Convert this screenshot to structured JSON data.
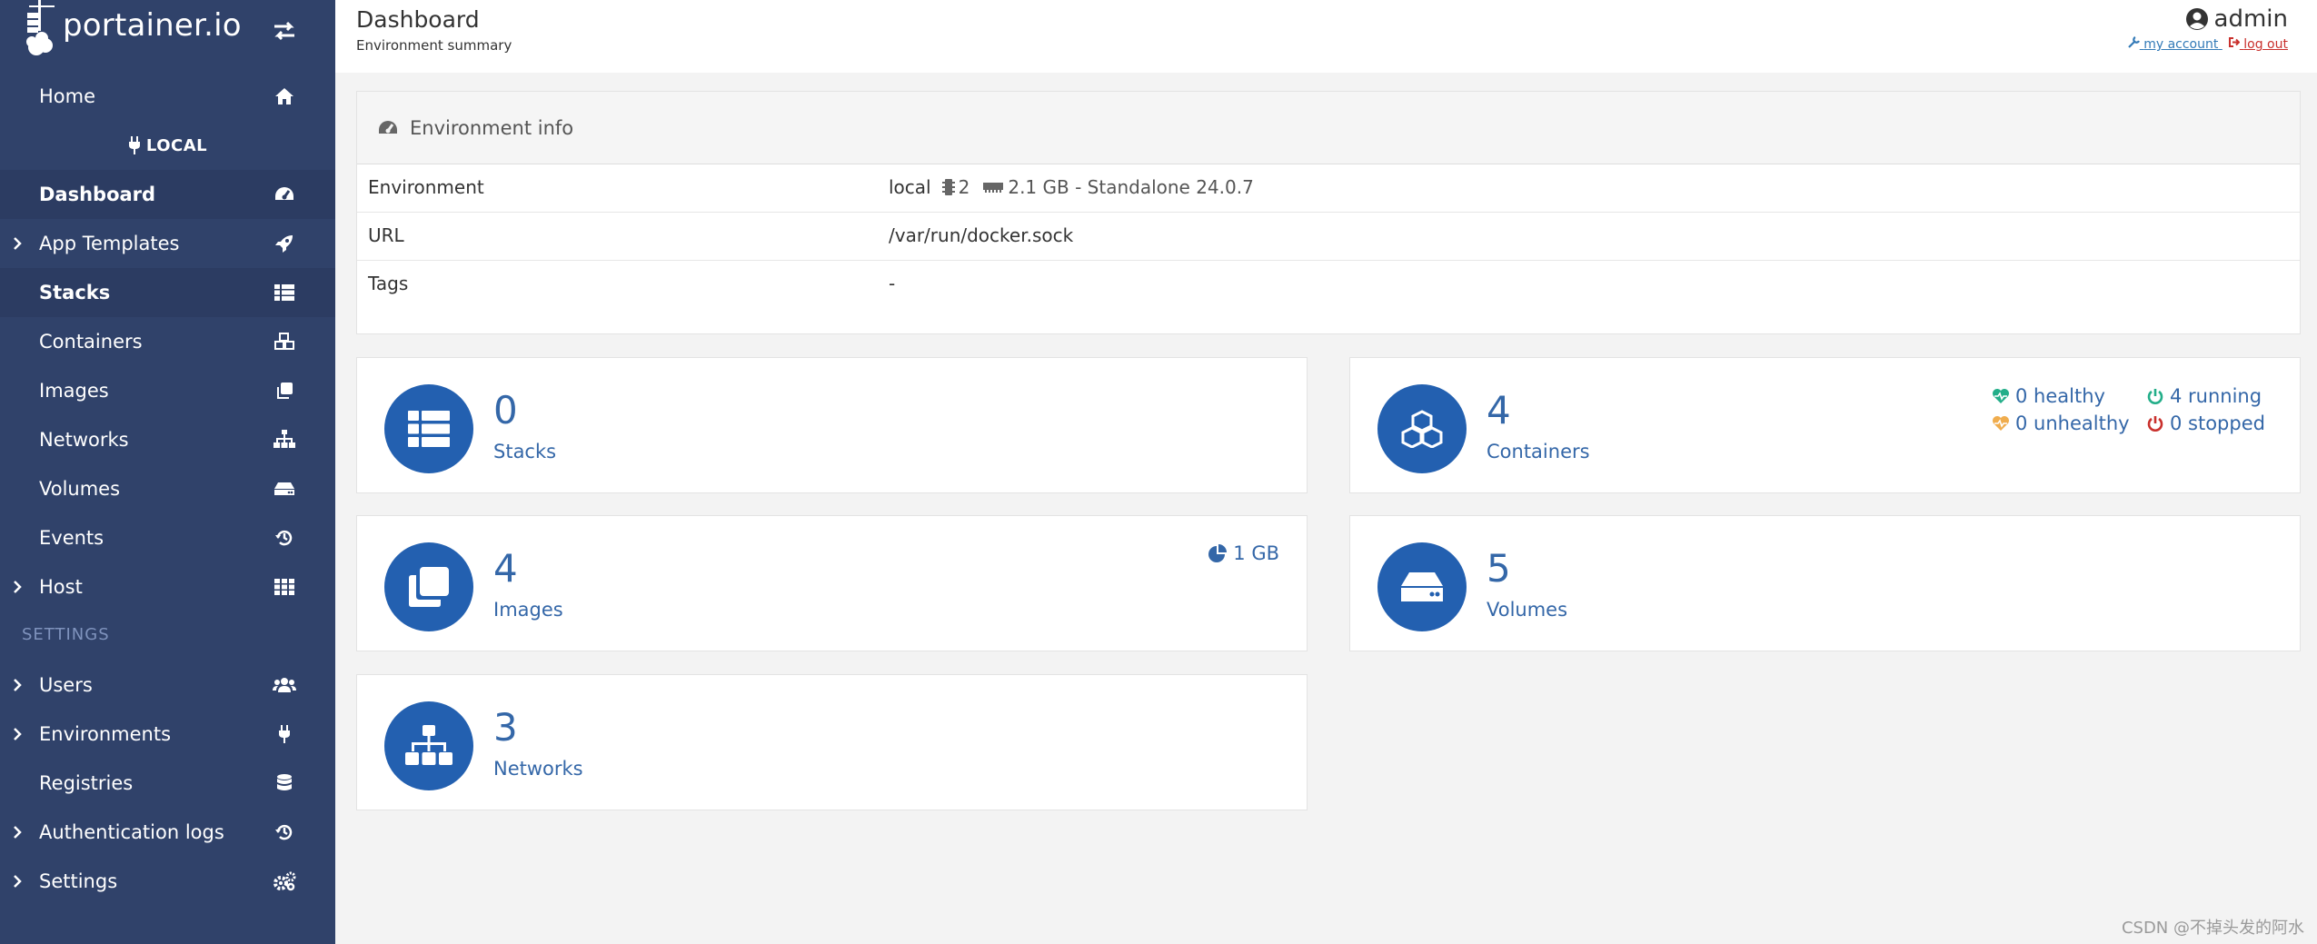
{
  "brand": {
    "name": "portainer.io"
  },
  "sidebar": {
    "home": "Home",
    "environment_name": "LOCAL",
    "items": [
      {
        "label": "Dashboard",
        "icon": "tachometer-icon",
        "active": true,
        "expandable": false
      },
      {
        "label": "App Templates",
        "icon": "rocket-icon",
        "active": false,
        "expandable": true
      },
      {
        "label": "Stacks",
        "icon": "th-list-icon",
        "active": true,
        "expandable": false
      },
      {
        "label": "Containers",
        "icon": "cubes-icon",
        "active": false,
        "expandable": false
      },
      {
        "label": "Images",
        "icon": "clone-icon",
        "active": false,
        "expandable": false
      },
      {
        "label": "Networks",
        "icon": "sitemap-icon",
        "active": false,
        "expandable": false
      },
      {
        "label": "Volumes",
        "icon": "hdd-icon",
        "active": false,
        "expandable": false
      },
      {
        "label": "Events",
        "icon": "history-icon",
        "active": false,
        "expandable": false
      },
      {
        "label": "Host",
        "icon": "th-icon",
        "active": false,
        "expandable": true
      }
    ],
    "settings_title": "SETTINGS",
    "settings_items": [
      {
        "label": "Users",
        "icon": "users-icon",
        "expandable": true
      },
      {
        "label": "Environments",
        "icon": "plug-icon",
        "expandable": true
      },
      {
        "label": "Registries",
        "icon": "database-icon",
        "expandable": false
      },
      {
        "label": "Authentication logs",
        "icon": "history-icon",
        "expandable": true
      },
      {
        "label": "Settings",
        "icon": "cogs-icon",
        "expandable": true
      }
    ]
  },
  "header": {
    "title": "Dashboard",
    "subtitle": "Environment summary",
    "username": "admin",
    "my_account": "my account",
    "log_out": "log out"
  },
  "env_info": {
    "title": "Environment info",
    "rows": {
      "environment": {
        "key": "Environment",
        "name": "local",
        "cpu": "2",
        "memory_details": "2.1 GB - Standalone 24.0.7"
      },
      "url": {
        "key": "URL",
        "value": "/var/run/docker.sock"
      },
      "tags": {
        "key": "Tags",
        "value": "-"
      }
    }
  },
  "widgets": {
    "stacks": {
      "count": "0",
      "label": "Stacks"
    },
    "containers": {
      "count": "4",
      "label": "Containers",
      "healthy": "0 healthy",
      "running": "4 running",
      "unhealthy": "0 unhealthy",
      "stopped": "0 stopped"
    },
    "images": {
      "count": "4",
      "label": "Images",
      "size": "1 GB"
    },
    "volumes": {
      "count": "5",
      "label": "Volumes"
    },
    "networks": {
      "count": "3",
      "label": "Networks"
    }
  },
  "colors": {
    "sidebar_bg": "#30426a",
    "accent_blue": "#2360b0",
    "text_blue": "#3467a8",
    "healthy_green": "#23ae89",
    "unhealthy_orange": "#f0ad4e",
    "stopped_red": "#c9302c"
  },
  "watermark": "CSDN @不掉头发的阿水"
}
